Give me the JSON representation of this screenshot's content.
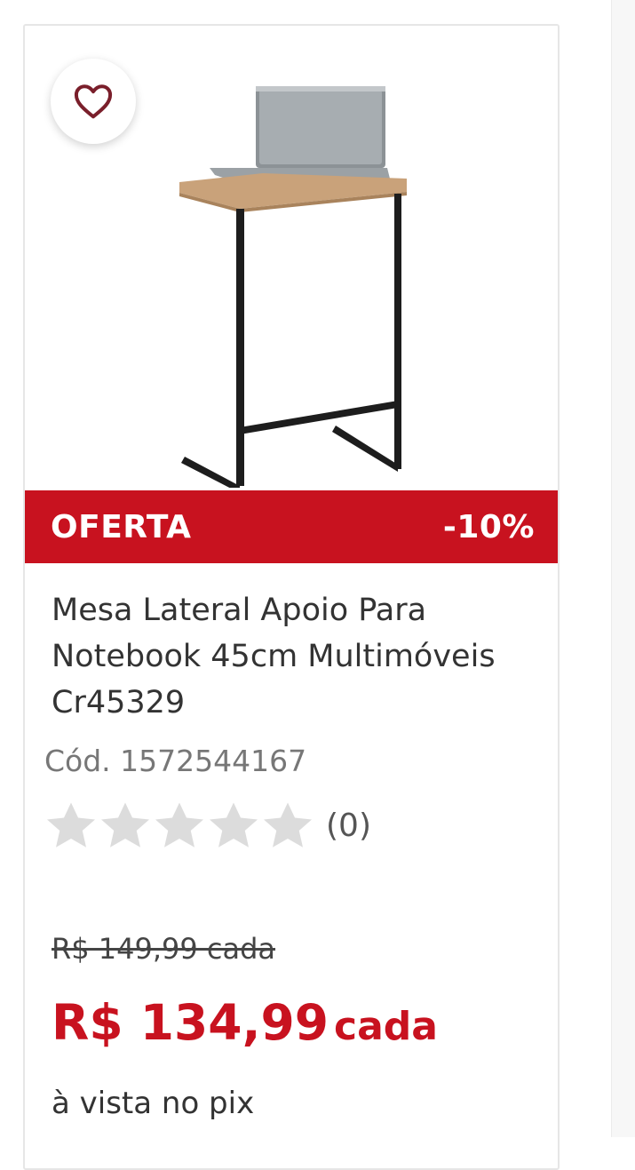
{
  "product": {
    "offer_label": "OFERTA",
    "discount": "-10%",
    "title": "Mesa Lateral Apoio Para Notebook 45cm Multimóveis Cr45329",
    "code": "Cód. 1572544167",
    "rating": {
      "stars": 0,
      "max": 5,
      "reviews": "(0)"
    },
    "old_price": "R$ 149,99 cada",
    "price": "R$ 134,99",
    "price_unit": "cada",
    "payment_note": "à vista no pix"
  },
  "icons": {
    "favorite": "heart-outline-icon",
    "rating": "star-icon"
  },
  "colors": {
    "accent": "#c8121f",
    "star_empty": "#dcdcdc",
    "text": "#333333",
    "muted": "#777777"
  }
}
